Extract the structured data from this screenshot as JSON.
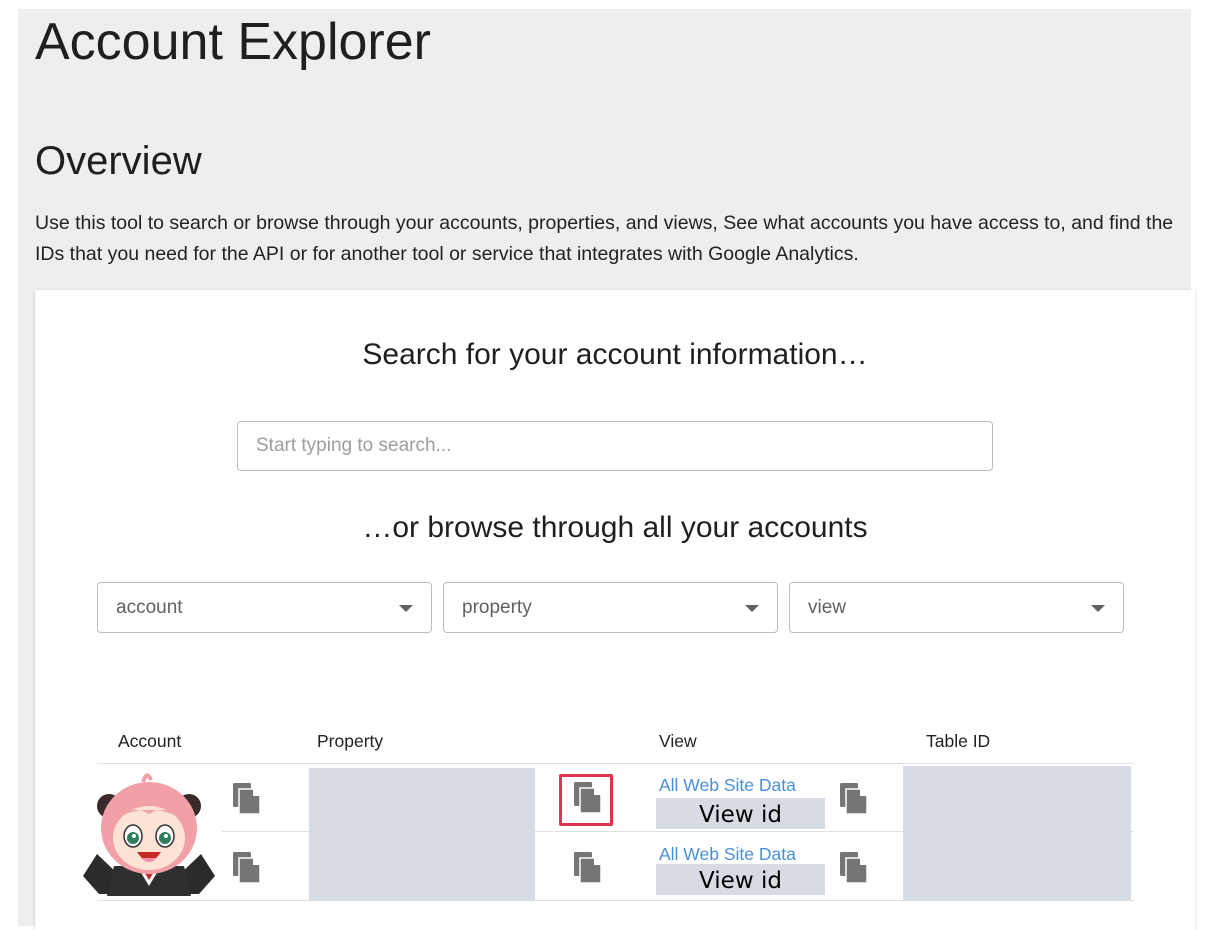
{
  "page": {
    "title": "Account Explorer",
    "overview_heading": "Overview",
    "overview_text": "Use this tool to search or browse through your accounts, properties, and views, See what accounts you have access to, and find the IDs that you need for the API or for another tool or service that integrates with Google Analytics."
  },
  "search": {
    "heading": "Search for your account information…",
    "placeholder": "Start typing to search..."
  },
  "browse": {
    "heading": "…or browse through all your accounts",
    "account_select": "account",
    "property_select": "property",
    "view_select": "view"
  },
  "table": {
    "headers": [
      "Account",
      "Property",
      "View",
      "Table ID"
    ],
    "rows": [
      {
        "view_name": "All Web Site Data",
        "view_id_label": "View id"
      },
      {
        "view_name": "All Web Site Data",
        "view_id_label": "View id"
      }
    ]
  },
  "icons": {
    "copy": "copy-icon",
    "dropdown": "chevron-down-icon"
  },
  "colors": {
    "link": "#4a90d9",
    "highlight": "#e0334f",
    "redaction": "#d7dce4"
  }
}
